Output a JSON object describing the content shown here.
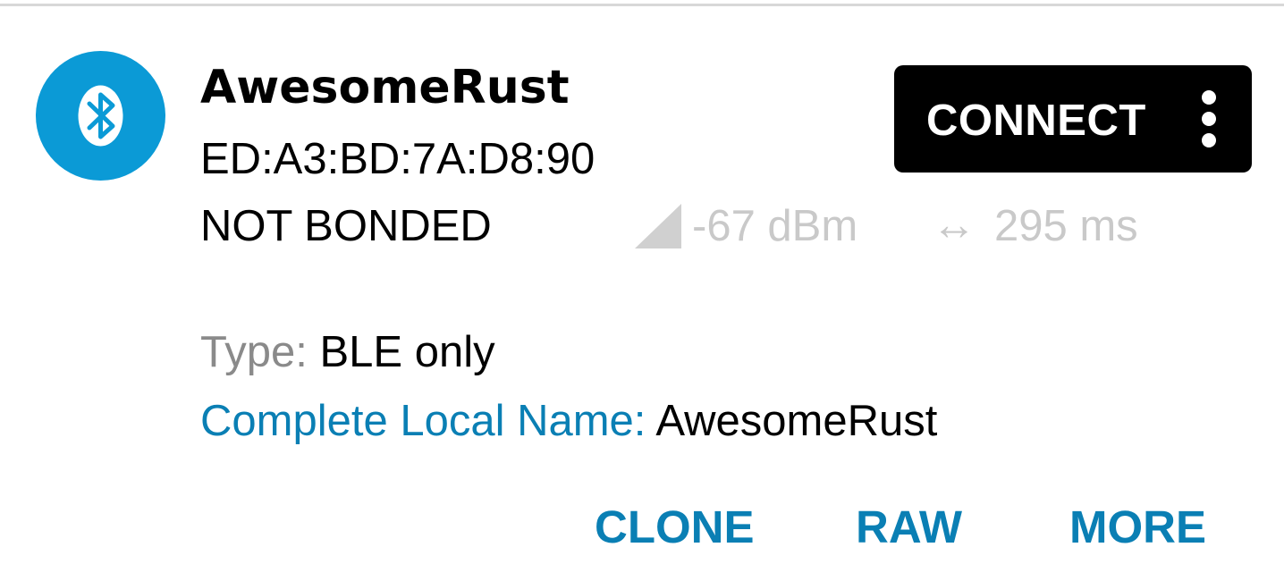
{
  "device": {
    "icon": "bluetooth-icon",
    "icon_bg_color": "#0b9ad6",
    "name": "AwesomeRust",
    "address": "ED:A3:BD:7A:D8:90",
    "bond_state": "NOT BONDED",
    "rssi": "-67 dBm",
    "interval_icon": "left-right-arrow-icon",
    "interval": "295 ms"
  },
  "connect": {
    "label": "CONNECT",
    "overflow_icon": "more-vert-icon"
  },
  "details": {
    "type_key": "Type:",
    "type_value": "BLE only",
    "local_name_key": "Complete Local Name:",
    "local_name_value": "AwesomeRust"
  },
  "actions": {
    "clone": "CLONE",
    "raw": "RAW",
    "more": "MORE"
  },
  "colors": {
    "accent": "#0a7fb4",
    "muted": "#c9c9c9",
    "connect_bg": "#000000"
  }
}
